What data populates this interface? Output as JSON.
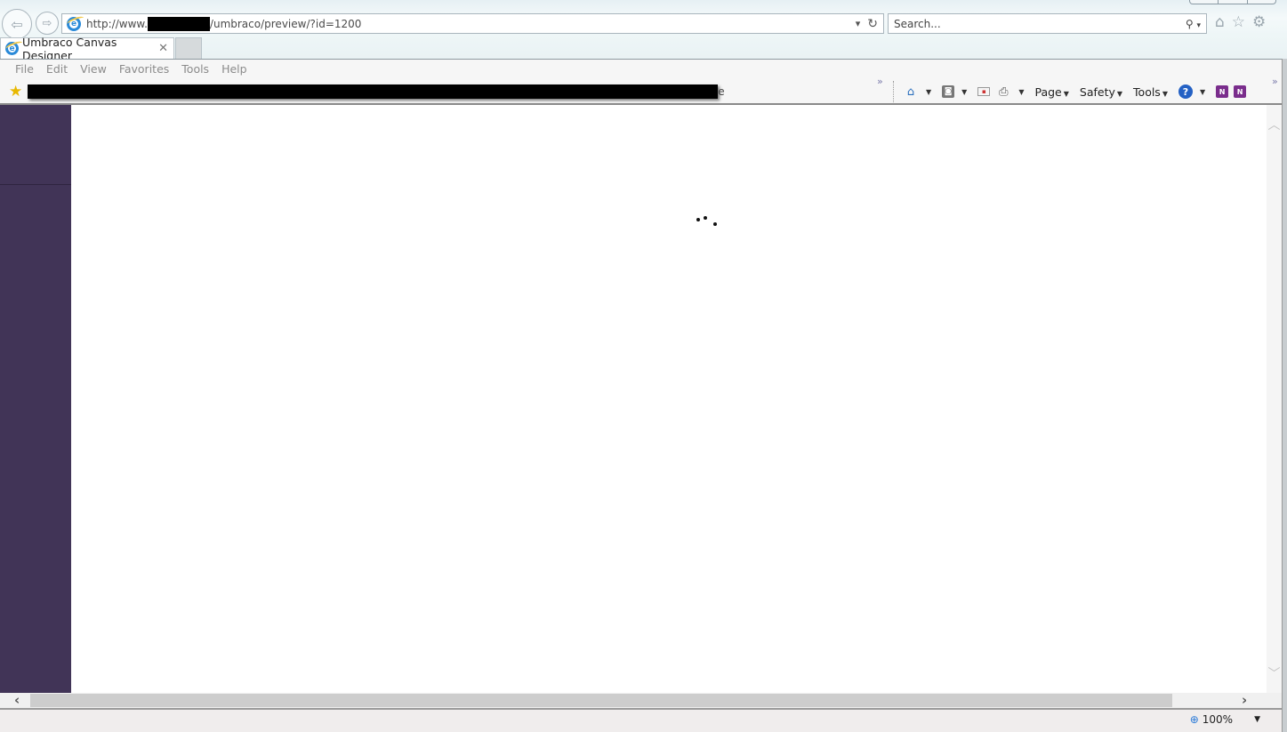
{
  "browser": {
    "address": {
      "prefix": "http://www.",
      "suffix": "/umbraco/preview/?id=1200"
    },
    "search": {
      "placeholder": "Search..."
    },
    "tab": {
      "title": "Umbraco Canvas Designer",
      "close_glyph": "✕"
    },
    "menu": [
      "File",
      "Edit",
      "View",
      "Favorites",
      "Tools",
      "Help"
    ],
    "favorites_tail": "e",
    "command_bar": {
      "page_label": "Page",
      "safety_label": "Safety",
      "tools_label": "Tools"
    },
    "icons": {
      "back": "back-arrow-icon",
      "forward": "forward-arrow-icon",
      "refresh": "refresh-icon",
      "search": "search-icon",
      "home": "home-icon",
      "favorites": "star-icon",
      "settings": "gear-icon"
    },
    "status": {
      "zoom_level": "100%"
    }
  },
  "page": {
    "sidebar_color": "#413457",
    "loading": true
  }
}
